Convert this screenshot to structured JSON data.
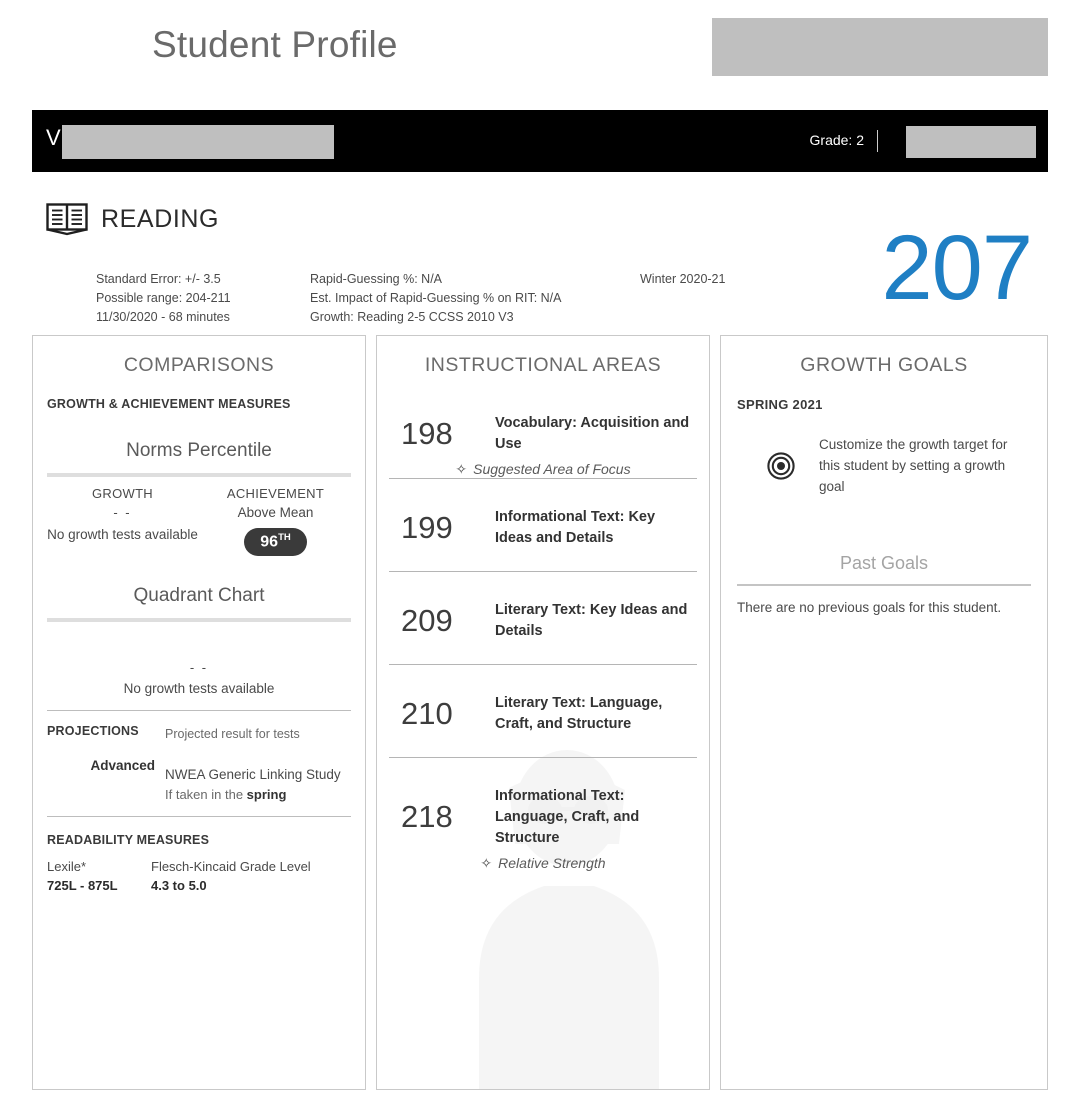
{
  "header": {
    "title": "Student Profile",
    "logo_placeholder": "redacted-logo",
    "student_initial": "V",
    "student_name_placeholder": "redacted-student-name",
    "grade_label": "Grade: 2",
    "right_placeholder": "redacted-school-name"
  },
  "subject": {
    "icon": "open-book-icon",
    "name": "READING",
    "rit_score": "207",
    "rit_color": "#1f7fc4"
  },
  "meta": {
    "col1": [
      "Standard Error: +/- 3.5",
      "Possible range: 204-211",
      "11/30/2020 - 68 minutes"
    ],
    "col2": [
      "Rapid-Guessing %: N/A",
      "Est. Impact of Rapid-Guessing % on RIT: N/A",
      "Growth: Reading 2-5 CCSS 2010 V3"
    ],
    "col3": [
      "Winter 2020-21"
    ]
  },
  "comparisons": {
    "title": "COMPARISONS",
    "section_label": "GROWTH & ACHIEVEMENT MEASURES",
    "norms_heading": "Norms Percentile",
    "growth": {
      "title": "GROWTH",
      "dashes": "- -",
      "note": "No growth tests available"
    },
    "achievement": {
      "title": "ACHIEVEMENT",
      "descriptor": "Above Mean",
      "percentile": "96",
      "percentile_suffix": "TH"
    },
    "quadrant_heading": "Quadrant Chart",
    "quadrant_dashes": "- -",
    "quadrant_note": "No growth tests available",
    "projections": {
      "label": "PROJECTIONS",
      "desc": "Projected result for tests",
      "value": "Advanced",
      "study": "NWEA Generic Linking Study",
      "condition_prefix": "If taken in the ",
      "condition_season": "spring"
    },
    "readability": {
      "heading": "READABILITY MEASURES",
      "lexile_label": "Lexile*",
      "lexile_value": "725L - 875L",
      "fk_label": "Flesch-Kincaid Grade Level",
      "fk_value": "4.3 to 5.0"
    }
  },
  "instructional": {
    "title": "INSTRUCTIONAL AREAS",
    "rows": [
      {
        "score": "198",
        "name": "Vocabulary: Acquisition and Use",
        "tag": "Suggested Area of Focus"
      },
      {
        "score": "199",
        "name": "Informational Text: Key Ideas and Details",
        "tag": ""
      },
      {
        "score": "209",
        "name": "Literary Text: Key Ideas and Details",
        "tag": ""
      },
      {
        "score": "210",
        "name": "Literary Text: Language, Craft, and Structure",
        "tag": ""
      },
      {
        "score": "218",
        "name": "Informational Text: Language, Craft, and Structure",
        "tag": "Relative Strength"
      }
    ]
  },
  "growth_goals": {
    "title": "GROWTH GOALS",
    "term": "SPRING 2021",
    "icon": "bullseye-target-icon",
    "customize_text": "Customize the growth target for this student by setting a growth goal",
    "past_goals_heading": "Past Goals",
    "past_goals_empty": "There are no previous goals for this student."
  }
}
